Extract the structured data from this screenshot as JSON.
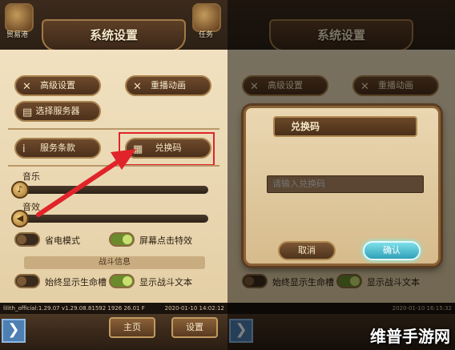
{
  "colors": {
    "highlight": "#e0242a",
    "arrow": "#e0242a",
    "confirm": "#3fb8cc"
  },
  "left": {
    "corner_left_label": "贸易港",
    "corner_right_label": "任务",
    "title": "系统设置",
    "buttons": {
      "advanced": "高级设置",
      "replay": "重播动画",
      "server": "选择服务器",
      "terms": "服务条款",
      "redeem": "兑换码"
    },
    "music_label": "音乐",
    "sfx_label": "音效",
    "toggles": {
      "power_save": {
        "label": "省电模式",
        "state": "off"
      },
      "tap_effect": {
        "label": "屏幕点击特效",
        "state": "on"
      },
      "show_hp": {
        "label": "始终显示生命槽",
        "state": "off"
      },
      "show_battle_text": {
        "label": "显示战斗文本",
        "state": "on"
      }
    },
    "section_title": "战斗信息",
    "version": "lilith_official:1.29.07  v1.29.08.81592 1926 26.01 F",
    "timestamp": "2020-01-10 14:02:12",
    "nav": {
      "home": "主页",
      "settings": "设置"
    }
  },
  "right": {
    "title": "系统设置",
    "buttons": {
      "advanced": "高级设置",
      "replay": "重播动画"
    },
    "dialog": {
      "title": "兑换码",
      "placeholder": "请输入兑换码",
      "cancel": "取消",
      "confirm": "确认"
    },
    "toggles": {
      "show_hp": "始终显示生命槽",
      "show_battle_text": "显示战斗文本"
    },
    "timestamp": "2020-01-10 16:15:32"
  },
  "watermark": "维普手游网"
}
